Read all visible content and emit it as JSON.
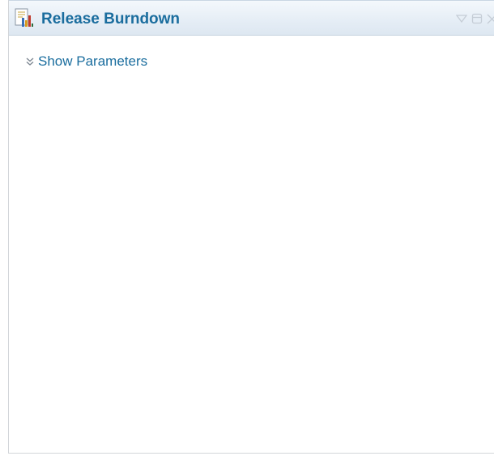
{
  "widget": {
    "title": "Release Burndown",
    "icon": "report-chart-icon",
    "controls": [
      "collapse-icon",
      "maximize-icon",
      "close-icon"
    ]
  },
  "parameters": {
    "toggle_label": "Show Parameters",
    "toggle_icon": "double-chevron-down-icon"
  },
  "colors": {
    "title": "#1a6d9e",
    "header_bg": "#e6eef6",
    "controls": "#c5cdd6"
  }
}
